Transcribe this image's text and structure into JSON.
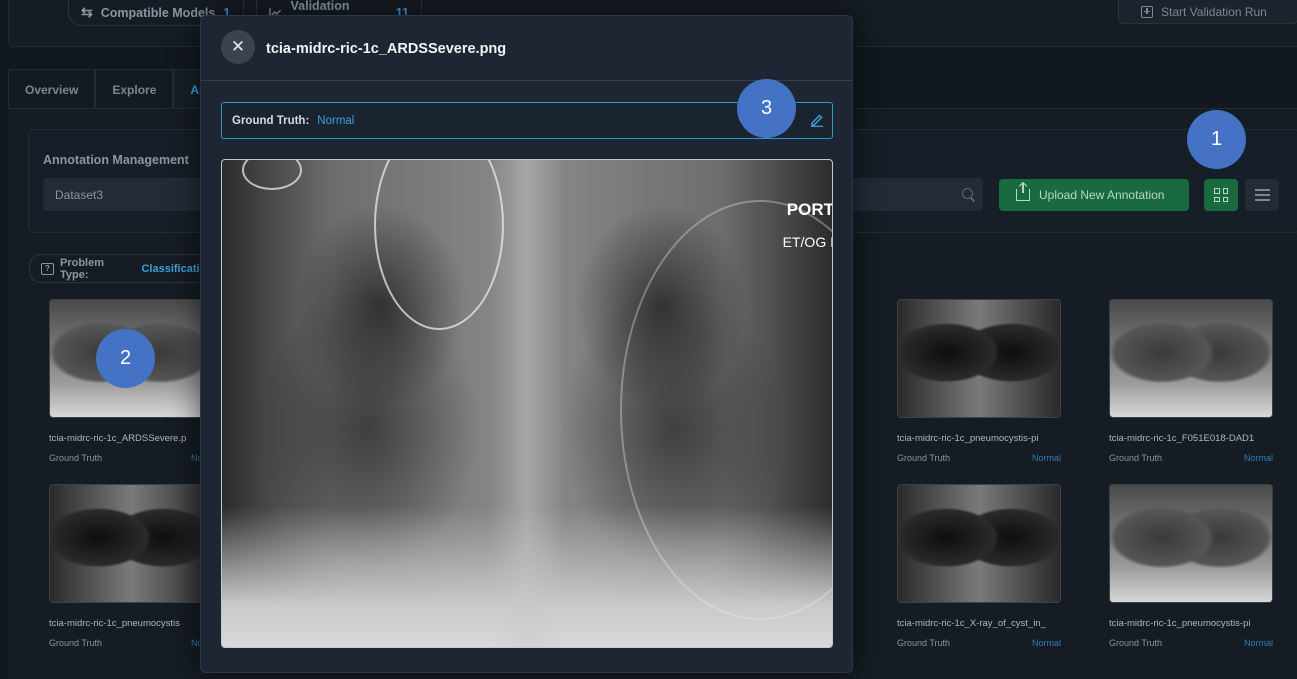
{
  "topbar": {
    "compatible_label": "Compatible Models",
    "compatible_count": "1",
    "validation_label": "Validation Status",
    "validation_count": "11",
    "start_label": "Start Validation Run"
  },
  "tabs": [
    {
      "label": "Overview"
    },
    {
      "label": "Explore"
    },
    {
      "label": "An"
    }
  ],
  "management": {
    "title": "Annotation Management",
    "dataset_value": "Dataset3",
    "upload_label": "Upload New Annotation"
  },
  "problem_type": {
    "label": "Problem Type:",
    "value": "Classification"
  },
  "cards": [
    {
      "name": "tcia-midrc-ric-1c_ARDSSevere.p",
      "gt_label": "Ground Truth",
      "gt_value": "Norm"
    },
    {
      "name": "tcia-midrc-ric-1c_pneumocystis-pi",
      "gt_label": "Ground Truth",
      "gt_value": "Normal"
    },
    {
      "name": "tcia-midrc-ric-1c_F051E018-DAD1",
      "gt_label": "Ground Truth",
      "gt_value": "Normal"
    },
    {
      "name": "tcia-midrc-ric-1c_pneumocystis",
      "gt_label": "Ground Truth",
      "gt_value": "Norm"
    },
    {
      "name": "tcia-midrc-ric-1c_X-ray_of_cyst_in_",
      "gt_label": "Ground Truth",
      "gt_value": "Normal"
    },
    {
      "name": "tcia-midrc-ric-1c_pneumocystis-pi",
      "gt_label": "Ground Truth",
      "gt_value": "Normal"
    }
  ],
  "modal": {
    "close_glyph": "✕",
    "title": "tcia-midrc-ric-1c_ARDSSevere.png",
    "gt_label": "Ground Truth:",
    "gt_value": "Normal",
    "image_text_1": "PORT",
    "image_text_2": "ET/OG I"
  },
  "markers": [
    "1",
    "2",
    "3"
  ],
  "colors": {
    "accent_blue": "#3fa0d8",
    "green": "#1a6a3f",
    "marker_blue": "#4472c4"
  }
}
